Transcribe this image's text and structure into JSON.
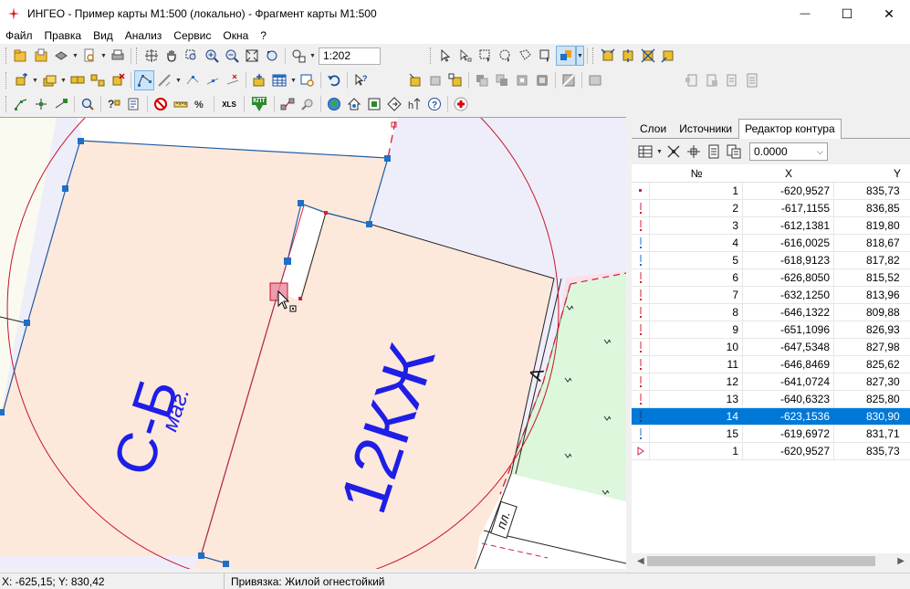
{
  "window": {
    "title": "ИНГЕО - Пример карты М1:500 (локально) - Фрагмент карты М1:500",
    "minimize": "—",
    "maximize": "☐",
    "close": "✕"
  },
  "menu": [
    "Файл",
    "Правка",
    "Вид",
    "Анализ",
    "Сервис",
    "Окна",
    "?"
  ],
  "toolbar": {
    "scale": "1:202",
    "xls_label": "XLS",
    "kpt_label": "КПТ"
  },
  "map": {
    "label_sb": "С-Б",
    "label_mag": "маг.",
    "label_12kzh": "12КЖ",
    "label_a": "А",
    "label_pl": "пл.",
    "colors": {
      "parcel_fill": "#fde8dc",
      "lavender": "#eeeefa",
      "green": "#dcf7dc",
      "vertex": "#1e6fc8",
      "red": "#d81e3a"
    }
  },
  "panel": {
    "tabs": [
      "Слои",
      "Источники",
      "Редактор контура"
    ],
    "active_tab": 2,
    "combo_value": "0.0000",
    "columns": {
      "n": "№",
      "x": "X",
      "y": "Y"
    },
    "rows": [
      {
        "n": "1",
        "x": "-620,9527",
        "y": "835,73",
        "mark": "square"
      },
      {
        "n": "2",
        "x": "-617,1155",
        "y": "836,85",
        "mark": "tick"
      },
      {
        "n": "3",
        "x": "-612,1381",
        "y": "819,80",
        "mark": "tick"
      },
      {
        "n": "4",
        "x": "-616,0025",
        "y": "818,67",
        "mark": "tick-blue"
      },
      {
        "n": "5",
        "x": "-618,9123",
        "y": "817,82",
        "mark": "tick-blue"
      },
      {
        "n": "6",
        "x": "-626,8050",
        "y": "815,52",
        "mark": "tick"
      },
      {
        "n": "7",
        "x": "-632,1250",
        "y": "813,96",
        "mark": "tick"
      },
      {
        "n": "8",
        "x": "-646,1322",
        "y": "809,88",
        "mark": "tick"
      },
      {
        "n": "9",
        "x": "-651,1096",
        "y": "826,93",
        "mark": "tick"
      },
      {
        "n": "10",
        "x": "-647,5348",
        "y": "827,98",
        "mark": "tick"
      },
      {
        "n": "11",
        "x": "-646,8469",
        "y": "825,62",
        "mark": "tick"
      },
      {
        "n": "12",
        "x": "-641,0724",
        "y": "827,30",
        "mark": "tick"
      },
      {
        "n": "13",
        "x": "-640,6323",
        "y": "825,80",
        "mark": "tick"
      },
      {
        "n": "14",
        "x": "-623,1536",
        "y": "830,90",
        "mark": "tick-white",
        "selected": true
      },
      {
        "n": "15",
        "x": "-619,6972",
        "y": "831,71",
        "mark": "tick-blue"
      },
      {
        "n": "1",
        "x": "-620,9527",
        "y": "835,73",
        "mark": "flag"
      }
    ]
  },
  "status": {
    "coords": "X: -625,15; Y: 830,42",
    "snap": "Привязка: Жилой огнестойкий"
  }
}
